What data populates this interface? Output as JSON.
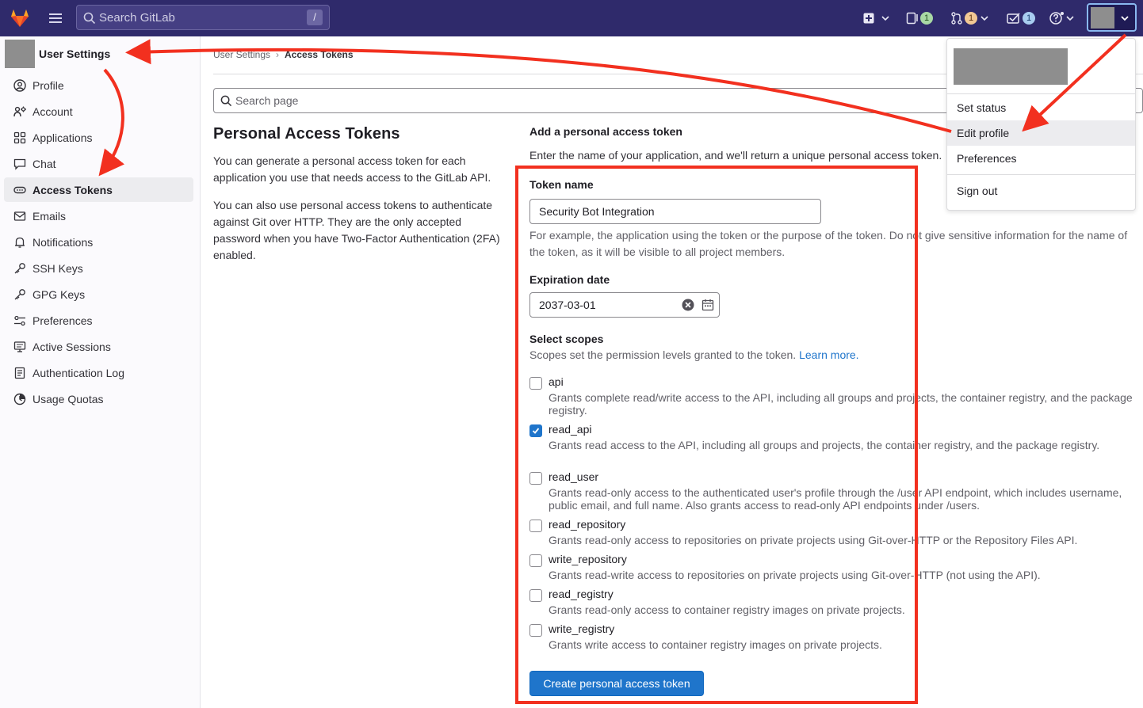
{
  "navbar": {
    "search_placeholder": "Search GitLab",
    "search_shortcut": "/",
    "issues_count": "1",
    "merge_requests_count": "1",
    "todos_count": "1"
  },
  "sidebar": {
    "title": "User Settings",
    "items": [
      {
        "label": "Profile",
        "icon": "profile-icon"
      },
      {
        "label": "Account",
        "icon": "account-icon"
      },
      {
        "label": "Applications",
        "icon": "applications-icon"
      },
      {
        "label": "Chat",
        "icon": "chat-icon"
      },
      {
        "label": "Access Tokens",
        "icon": "token-icon",
        "active": true
      },
      {
        "label": "Emails",
        "icon": "mail-icon"
      },
      {
        "label": "Notifications",
        "icon": "bell-icon"
      },
      {
        "label": "SSH Keys",
        "icon": "key-icon"
      },
      {
        "label": "GPG Keys",
        "icon": "key-icon"
      },
      {
        "label": "Preferences",
        "icon": "preferences-icon"
      },
      {
        "label": "Active Sessions",
        "icon": "monitor-icon"
      },
      {
        "label": "Authentication Log",
        "icon": "log-icon"
      },
      {
        "label": "Usage Quotas",
        "icon": "quota-icon"
      }
    ]
  },
  "breadcrumb": {
    "parent": "User Settings",
    "separator": "›",
    "current": "Access Tokens"
  },
  "search_page": {
    "placeholder": "Search page"
  },
  "intro": {
    "title": "Personal Access Tokens",
    "paragraph_1": "You can generate a personal access token for each application you use that needs access to the GitLab API.",
    "paragraph_2": "You can also use personal access tokens to authenticate against Git over HTTP. They are the only accepted password when you have Two-Factor Authentication (2FA) enabled."
  },
  "form": {
    "title": "Add a personal access token",
    "description": "Enter the name of your application, and we'll return a unique personal access token.",
    "token_name_label": "Token name",
    "token_name_value": "Security Bot Integration",
    "token_name_help": "For example, the application using the token or the purpose of the token. Do not give sensitive information for the name of the token, as it will be visible to all project members.",
    "expiration_label": "Expiration date",
    "expiration_value": "2037-03-01",
    "scopes_label": "Select scopes",
    "scopes_help": "Scopes set the permission levels granted to the token.",
    "learn_more": "Learn more.",
    "scopes": [
      {
        "name": "api",
        "checked": false,
        "description": "Grants complete read/write access to the API, including all groups and projects, the container registry, and the package registry."
      },
      {
        "name": "read_api",
        "checked": true,
        "description": "Grants read access to the API, including all groups and projects, the container registry, and the package registry."
      },
      {
        "name": "read_user",
        "checked": false,
        "description": "Grants read-only access to the authenticated user's profile through the /user API endpoint, which includes username, public email, and full name. Also grants access to read-only API endpoints under /users."
      },
      {
        "name": "read_repository",
        "checked": false,
        "description": "Grants read-only access to repositories on private projects using Git-over-HTTP or the Repository Files API."
      },
      {
        "name": "write_repository",
        "checked": false,
        "description": "Grants read-write access to repositories on private projects using Git-over-HTTP (not using the API)."
      },
      {
        "name": "read_registry",
        "checked": false,
        "description": "Grants read-only access to container registry images on private projects."
      },
      {
        "name": "write_registry",
        "checked": false,
        "description": "Grants write access to container registry images on private projects."
      }
    ],
    "submit_label": "Create personal access token"
  },
  "user_menu": {
    "items": [
      "Set status",
      "Edit profile",
      "Preferences",
      "Sign out"
    ]
  },
  "colors": {
    "navbar": "#2f2a6b",
    "primary": "#1f75cb",
    "annotation": "#f2301f"
  }
}
